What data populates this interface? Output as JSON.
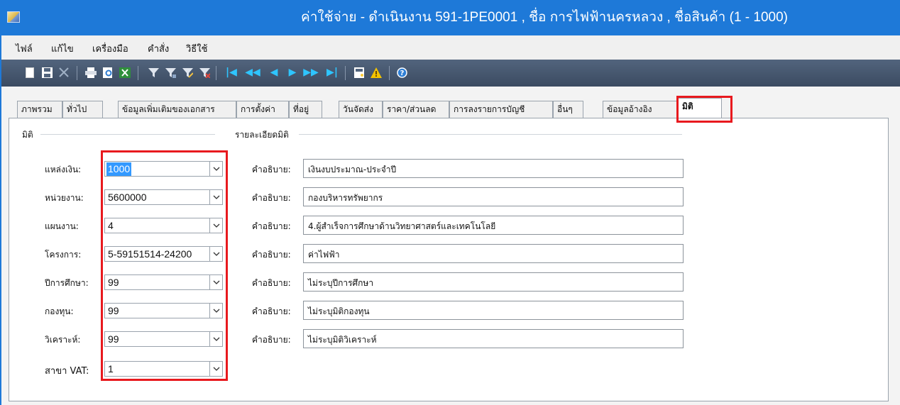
{
  "window": {
    "title": "ค่าใช้จ่าย - ดำเนินงาน 591-1PE0001 , ชื่อ การไฟฟ้านครหลวง , ชื่อสินค้า (1 - 1000)"
  },
  "menu": [
    "ไฟล์",
    "แก้ไข",
    "เครื่องมือ",
    "คำสั่ง",
    "วิธีใช้"
  ],
  "tabs": [
    "ภาพรวม",
    "ทั่วไป",
    "ข้อมูลเพิ่มเติมของเอกสาร",
    "การตั้งค่า",
    "ที่อยู่",
    "วันจัดส่ง",
    "ราคา/ส่วนลด",
    "การลงรายการบัญชี",
    "อื่นๆ",
    "ข้อมูลอ้างอิง",
    "มิติ"
  ],
  "active_tab": "มิติ",
  "dimension_group": {
    "title": "มิติ",
    "fields": [
      {
        "label": "แหล่งเงิน:",
        "value": "1000"
      },
      {
        "label": "หน่วยงาน:",
        "value": "5600000"
      },
      {
        "label": "แผนงาน:",
        "value": "4"
      },
      {
        "label": "โครงการ:",
        "value": "5-59151514-24200"
      },
      {
        "label": "ปีการศึกษา:",
        "value": "99"
      },
      {
        "label": "กองทุน:",
        "value": "99"
      },
      {
        "label": "วิเคราะห์:",
        "value": "99"
      },
      {
        "label": "สาขา VAT:",
        "value": "1"
      }
    ]
  },
  "detail_group": {
    "title": "รายละเอียดมิติ",
    "rows": [
      {
        "label": "คำอธิบาย:",
        "value": "เงินงบประมาณ-ประจำปี"
      },
      {
        "label": "คำอธิบาย:",
        "value": "กองบริหารทรัพยากร"
      },
      {
        "label": "คำอธิบาย:",
        "value": "4.ผู้สำเร็จการศึกษาด้านวิทยาศาสตร์และเทคโนโลยี"
      },
      {
        "label": "คำอธิบาย:",
        "value": "ค่าไฟฟ้า"
      },
      {
        "label": "คำอธิบาย:",
        "value": "ไม่ระบุปีการศึกษา"
      },
      {
        "label": "คำอธิบาย:",
        "value": "ไม่ระบุมิติกองทุน"
      },
      {
        "label": "คำอธิบาย:",
        "value": "ไม่ระบุมิติวิเคราะห์"
      }
    ]
  },
  "toolbar_icons": [
    "new-icon",
    "save-icon",
    "delete-icon",
    "print-icon",
    "print-preview-icon",
    "export-excel-icon",
    "filter-icon",
    "filter-by-selection-icon",
    "advanced-filter-icon",
    "remove-filter-icon",
    "first-record-icon",
    "previous-page-icon",
    "previous-record-icon",
    "next-record-icon",
    "next-page-icon",
    "last-record-icon",
    "document-handling-icon",
    "alert-icon",
    "help-icon"
  ],
  "colors": {
    "titlebar": "#1e79d8",
    "toolbar": "#3e4e64",
    "highlight": "#e8191e",
    "selection": "#3399ff"
  }
}
